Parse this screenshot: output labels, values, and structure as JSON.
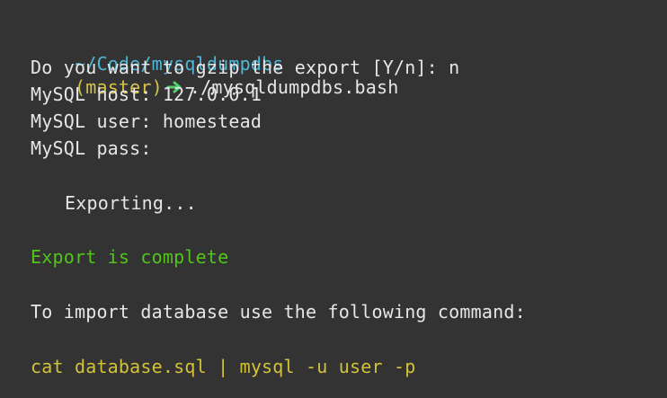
{
  "prompt": {
    "path": "~/Code/mysqldumpdbs",
    "branch": "(master)",
    "arrow_icon": "arrow-right-icon",
    "command": "./mysqldumpdbs.bash"
  },
  "output": {
    "gzip_question": "Do you want to gzip the export [Y/n]: n",
    "host_line": "MySQL host: 127.0.0.1",
    "user_line": "MySQL user: homestead",
    "pass_line": "MySQL pass:",
    "exporting": "Exporting...",
    "complete": "Export is complete",
    "import_hint": "To import database use the following command:",
    "import_command": "cat database.sql | mysql -u user -p"
  },
  "colors": {
    "background": "#333333",
    "path": "#4fb8d6",
    "branch": "#d8c34a",
    "arrow": "#4fd06a",
    "text": "#e6e6e6",
    "success": "#52c41a",
    "command_hint": "#d3c236"
  }
}
